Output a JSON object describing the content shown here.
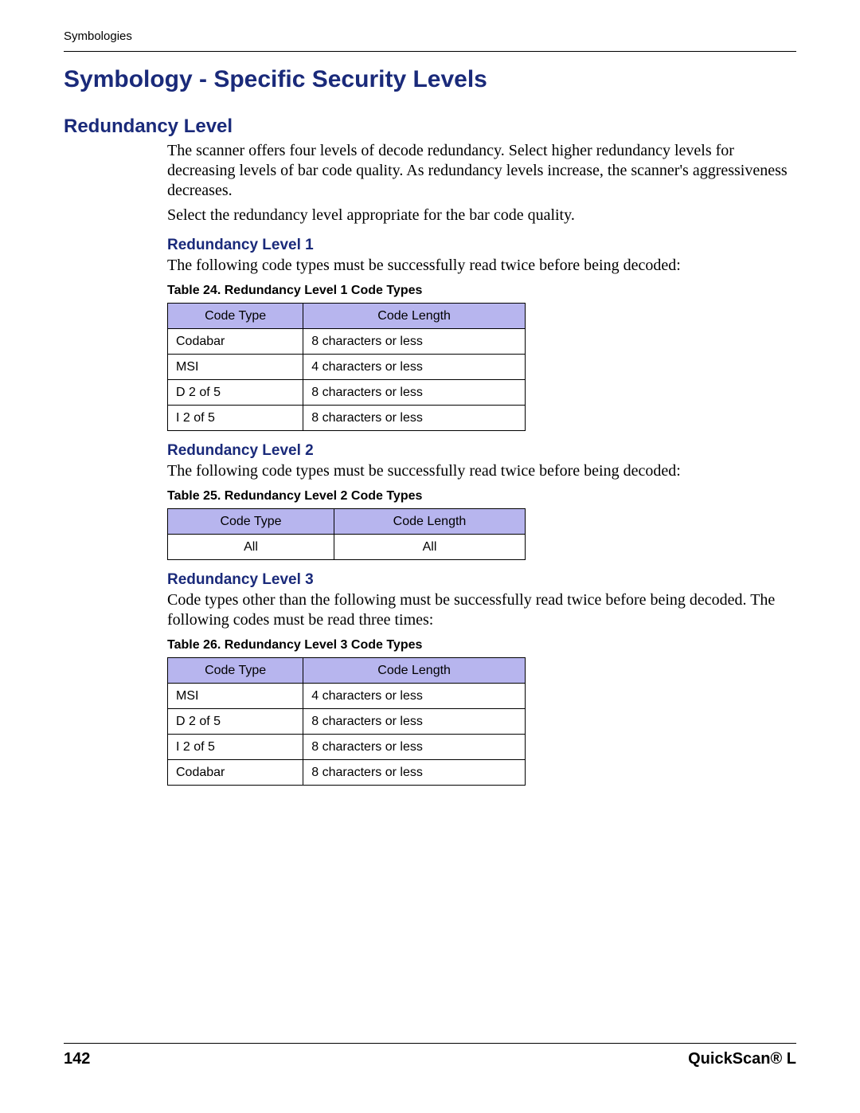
{
  "running_header": "Symbologies",
  "h1": "Symbology - Specific Security Levels",
  "h2": "Redundancy Level",
  "intro_p1": "The scanner offers four levels of decode redundancy. Select higher redundancy levels for decreasing levels of bar code quality. As redundancy levels increase, the scanner's aggressiveness decreases.",
  "intro_p2": "Select the redundancy level appropriate for the bar code quality.",
  "level1": {
    "heading": "Redundancy Level 1",
    "text": "The following code types must be successfully read twice before being decoded:",
    "caption": "Table 24. Redundancy Level 1 Code Types",
    "headers": {
      "col1": "Code Type",
      "col2": "Code Length"
    },
    "rows": [
      {
        "type": "Codabar",
        "length": "8 characters or less"
      },
      {
        "type": "MSI",
        "length": "4 characters or less"
      },
      {
        "type": "D 2 of 5",
        "length": "8 characters or less"
      },
      {
        "type": "I 2 of 5",
        "length": "8 characters or less"
      }
    ]
  },
  "level2": {
    "heading": "Redundancy Level 2",
    "text": "The following code types must be successfully read twice before being decoded:",
    "caption": "Table 25. Redundancy Level 2 Code Types",
    "headers": {
      "col1": "Code Type",
      "col2": "Code Length"
    },
    "rows": [
      {
        "type": "All",
        "length": "All"
      }
    ]
  },
  "level3": {
    "heading": "Redundancy Level 3",
    "text": "Code types other than the following must be successfully read twice before being decoded. The following codes must be read three times:",
    "caption": "Table 26. Redundancy Level 3 Code Types",
    "headers": {
      "col1": "Code Type",
      "col2": "Code Length"
    },
    "rows": [
      {
        "type": "MSI",
        "length": "4 characters or less"
      },
      {
        "type": "D 2 of 5",
        "length": "8 characters or less"
      },
      {
        "type": "I 2 of 5",
        "length": "8 characters or less"
      },
      {
        "type": "Codabar",
        "length": "8 characters or less"
      }
    ]
  },
  "footer": {
    "page": "142",
    "product": "QuickScan® L"
  }
}
